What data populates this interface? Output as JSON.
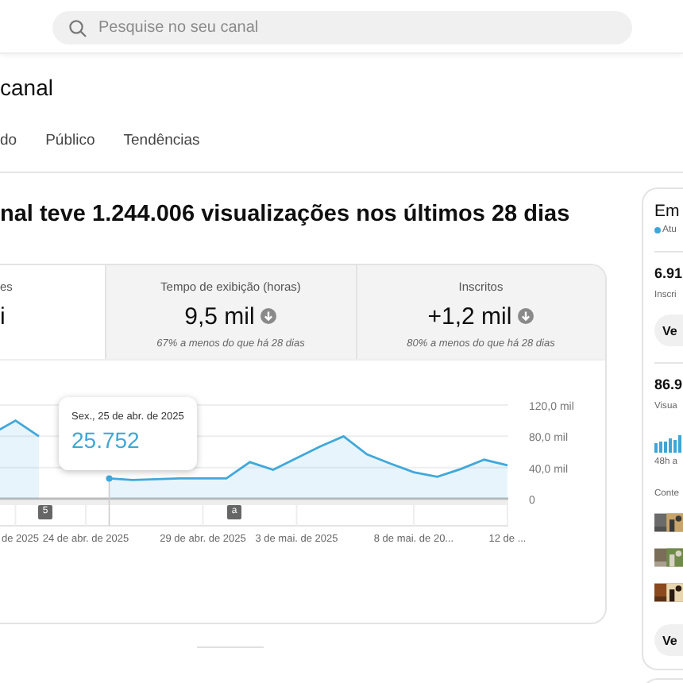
{
  "search": {
    "placeholder": "Pesquise no seu canal"
  },
  "page_title": "canal",
  "tabs": [
    {
      "label": "do"
    },
    {
      "label": "Público"
    },
    {
      "label": "Tendências"
    }
  ],
  "headline": "nal teve 1.244.006 visualizações nos últimos 28 dias",
  "metrics": [
    {
      "label": "es",
      "value": "i",
      "selected": true
    },
    {
      "label": "Tempo de exibição (horas)",
      "value": "9,5 mil",
      "note": "67% a menos do que há 28 dias",
      "selected": false
    },
    {
      "label": "Inscritos",
      "value": "+1,2 mil",
      "note": "80% a menos do que há 28 dias",
      "selected": false
    }
  ],
  "chart_data": {
    "type": "area",
    "categories": [
      null,
      "de 2025",
      null,
      null,
      "24 de abr. de 2025",
      null,
      null,
      null,
      null,
      "29 de abr. de 2025",
      null,
      null,
      null,
      "3 de mai. de 2025",
      null,
      null,
      null,
      null,
      "8 de mai. de 20...",
      null,
      null,
      null,
      "12 de ..."
    ],
    "series": [
      {
        "color": "#41a8da",
        "values": [
          83,
          100,
          80,
          null,
          null,
          26,
          24,
          25,
          26,
          26,
          26,
          47,
          37,
          52,
          67,
          80,
          57,
          45,
          34,
          28,
          38,
          50,
          43
        ]
      }
    ],
    "ylim": [
      0,
      120
    ],
    "yticks": [
      {
        "value": 0,
        "label": "0"
      },
      {
        "value": 40,
        "label": "40,0 mil"
      },
      {
        "value": 80,
        "label": "80,0 mil"
      },
      {
        "value": 120,
        "label": "120,0 mil"
      }
    ]
  },
  "tooltip": {
    "date": "Sex., 25 de abr. de 2025",
    "value": "25.752"
  },
  "video_markers": [
    {
      "label": "5"
    },
    {
      "label": "a"
    }
  ],
  "side": {
    "title": "Em",
    "status": "Atu",
    "subscribers": "6.91",
    "subscribers_label": "Inscri",
    "button": "Ve",
    "views": "86.9",
    "views_label": "Visua",
    "period": "48h a",
    "content_label": "Conte",
    "bottom_button": "Ve"
  }
}
